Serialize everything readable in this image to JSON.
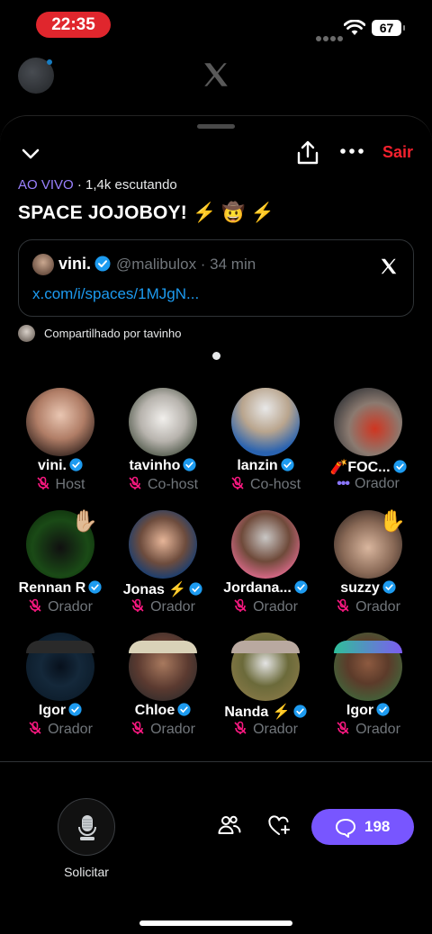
{
  "status_bar": {
    "time": "22:35",
    "battery": "67"
  },
  "header": {
    "leave_label": "Sair"
  },
  "space": {
    "live_label": "AO VIVO",
    "listeners_text": " · 1,4k escutando",
    "title": "SPACE JOJOBOY! ⚡ 🤠 ⚡"
  },
  "tweet_card": {
    "name": "vini.",
    "handle_time": "@malibulox · 34 min",
    "link": "x.com/i/spaces/1MJgN..."
  },
  "shared_by": "Compartilhado por tavinho",
  "participants": [
    {
      "name": "vini.",
      "role": "Host",
      "mic": "muted"
    },
    {
      "name": "tavinho",
      "role": "Co-host",
      "mic": "muted"
    },
    {
      "name": "lanzin",
      "role": "Co-host",
      "mic": "muted"
    },
    {
      "name": "🧨FOC...",
      "role": "Orador",
      "mic": "speaking"
    },
    {
      "name": "Rennan R",
      "role": "Orador",
      "mic": "muted",
      "hand": "✋🏼"
    },
    {
      "name": "Jonas ⚡",
      "role": "Orador",
      "mic": "muted"
    },
    {
      "name": "Jordana...",
      "role": "Orador",
      "mic": "muted"
    },
    {
      "name": "suzzy",
      "role": "Orador",
      "mic": "muted",
      "hand": "✋"
    },
    {
      "name": "Igor",
      "role": "Orador",
      "mic": "muted"
    },
    {
      "name": "Chloe",
      "role": "Orador",
      "mic": "muted"
    },
    {
      "name": "Nanda ⚡",
      "role": "Orador",
      "mic": "muted"
    },
    {
      "name": "Igor",
      "role": "Orador",
      "mic": "muted"
    }
  ],
  "bottom_bar": {
    "request_label": "Solicitar",
    "comments_count": "198"
  },
  "colors": {
    "accent_purple": "#7856ff",
    "live_purple": "#9a81ff",
    "leave_red": "#f4212e",
    "muted_pink": "#f91880",
    "verified_blue": "#1d9bf0"
  }
}
